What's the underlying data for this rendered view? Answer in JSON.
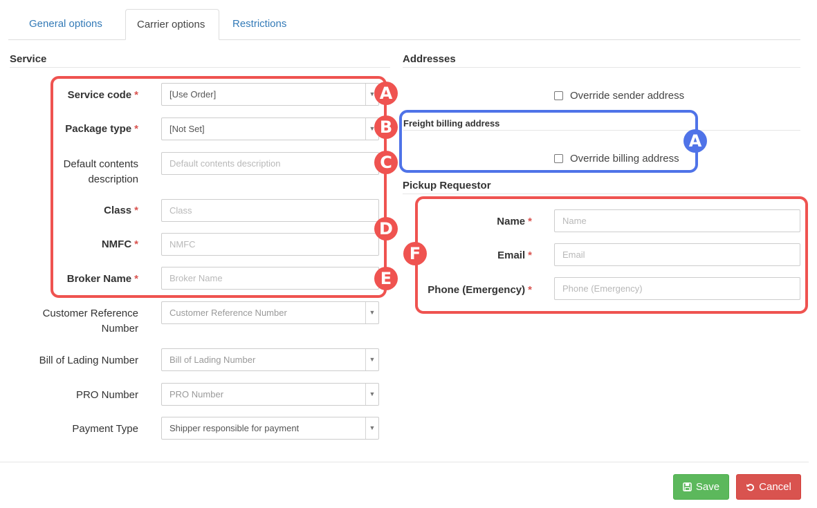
{
  "tabs": {
    "general": "General options",
    "carrier": "Carrier options",
    "restrictions": "Restrictions"
  },
  "service": {
    "title": "Service",
    "fields": {
      "service_code": {
        "label": "Service code",
        "value": "[Use Order]",
        "required": "*"
      },
      "package_type": {
        "label": "Package type",
        "value": "[Not Set]",
        "required": "*"
      },
      "default_contents": {
        "label_line1": "Default contents",
        "label_line2": "description",
        "placeholder": "Default contents description"
      },
      "class": {
        "label": "Class",
        "placeholder": "Class",
        "required": "*"
      },
      "nmfc": {
        "label": "NMFC",
        "placeholder": "NMFC",
        "required": "*"
      },
      "broker_name": {
        "label": "Broker Name",
        "placeholder": "Broker Name",
        "required": "*"
      },
      "customer_reference": {
        "label_line1": "Customer Reference",
        "label_line2": "Number",
        "placeholder": "Customer Reference Number"
      },
      "bill_of_lading": {
        "label": "Bill of Lading Number",
        "placeholder": "Bill of Lading Number"
      },
      "pro_number": {
        "label": "PRO Number",
        "placeholder": "PRO Number"
      },
      "payment_type": {
        "label": "Payment Type",
        "value": "Shipper responsible for payment"
      }
    }
  },
  "addresses": {
    "title": "Addresses",
    "override_sender": "Override sender address",
    "freight_billing_title": "Freight billing address",
    "override_billing": "Override billing address"
  },
  "pickup": {
    "title": "Pickup Requestor",
    "name": {
      "label": "Name",
      "placeholder": "Name",
      "required": "*"
    },
    "email": {
      "label": "Email",
      "placeholder": "Email",
      "required": "*"
    },
    "phone": {
      "label": "Phone (Emergency)",
      "placeholder": "Phone (Emergency)",
      "required": "*"
    }
  },
  "annotations": {
    "badge_a": "A",
    "badge_b": "B",
    "badge_c": "C",
    "badge_d": "D",
    "badge_e": "E",
    "badge_f": "F",
    "badge_blue_a": "A"
  },
  "buttons": {
    "save": "Save",
    "cancel": "Cancel"
  },
  "colors": {
    "link": "#337ab7",
    "required": "#d9534f",
    "annotation_red": "#ef5350",
    "annotation_blue": "#4f73e8",
    "save": "#5cb85c",
    "cancel": "#d9534f"
  },
  "icons": {
    "save": "floppy-disk-icon",
    "cancel": "undo-icon",
    "dropdown": "caret-down-icon"
  }
}
